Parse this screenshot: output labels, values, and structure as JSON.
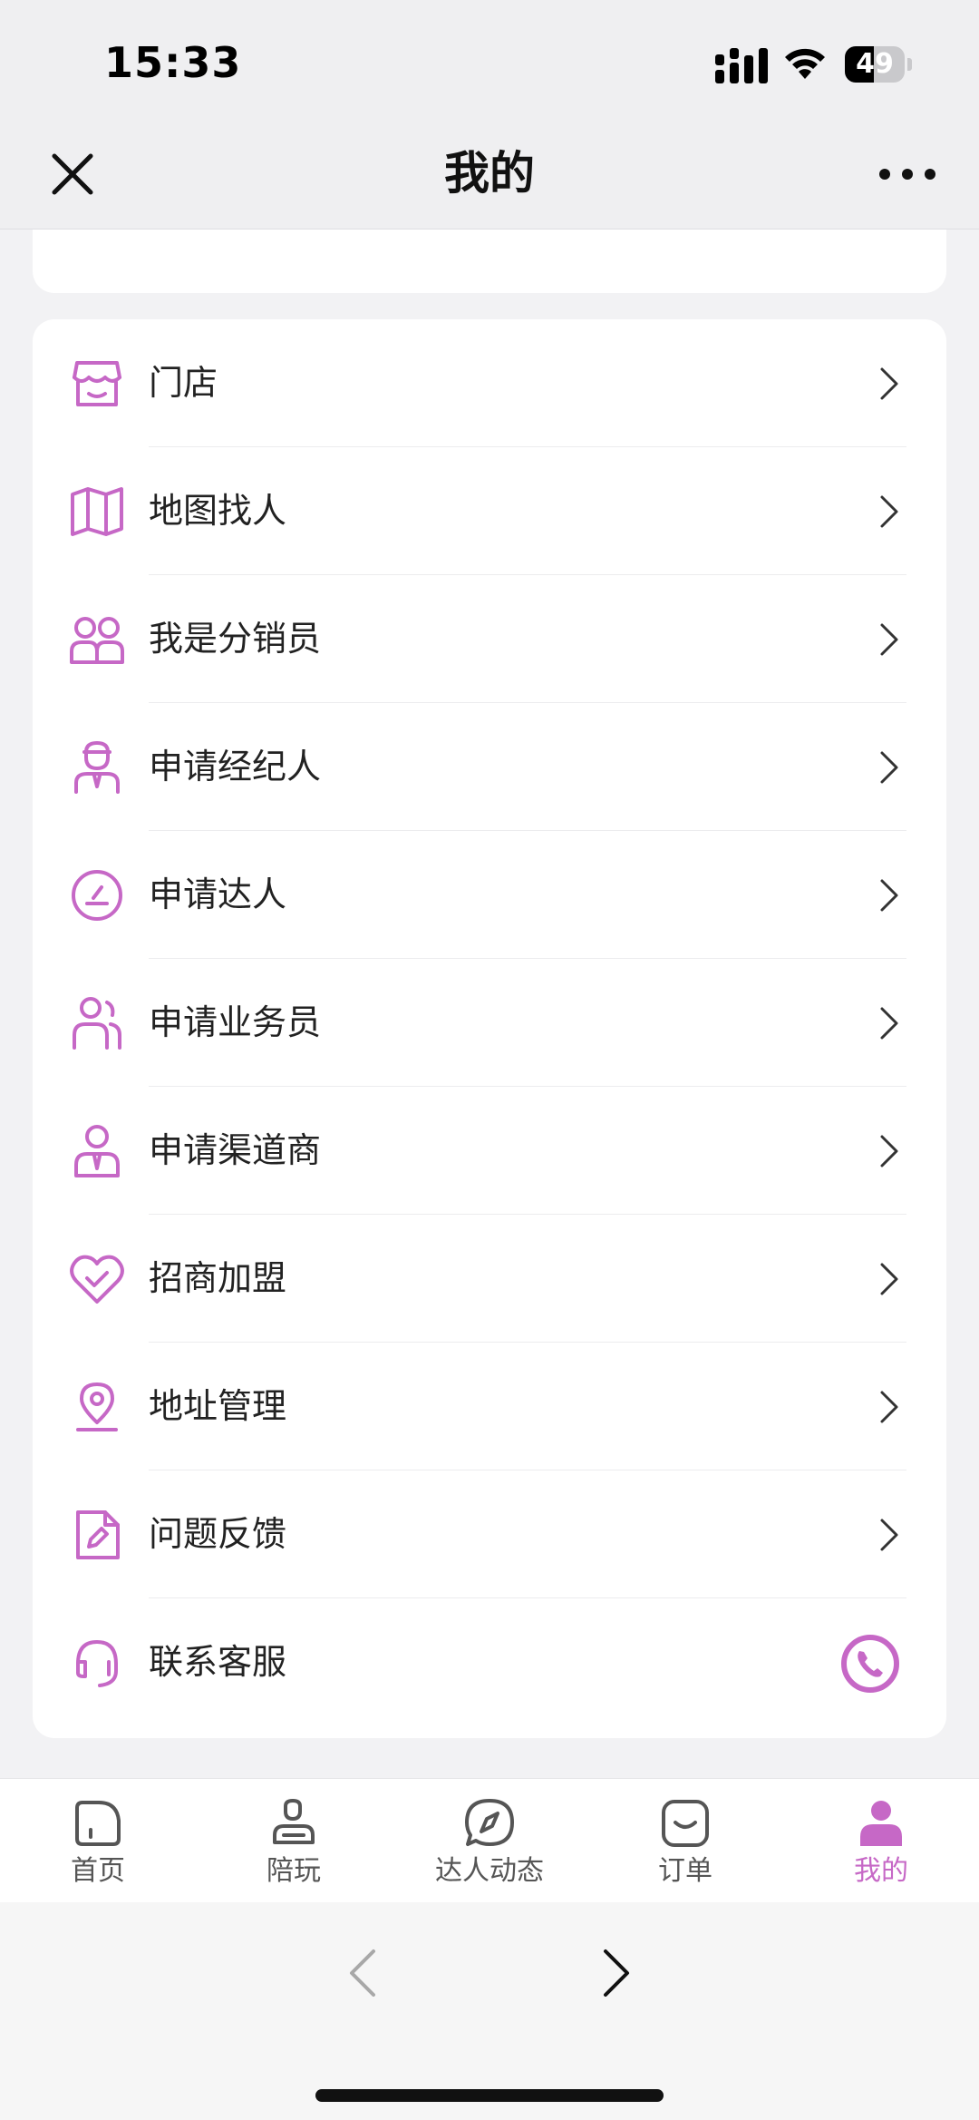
{
  "status_bar": {
    "time": "15:33",
    "battery": "49",
    "battery_level_percent": 49
  },
  "nav": {
    "title": "我的"
  },
  "accent_color": "#c668c6",
  "menu": {
    "items": [
      {
        "label": "门店",
        "icon": "store-icon"
      },
      {
        "label": "地图找人",
        "icon": "map-icon"
      },
      {
        "label": "我是分销员",
        "icon": "users-icon"
      },
      {
        "label": "申请经纪人",
        "icon": "agent-icon"
      },
      {
        "label": "申请达人",
        "icon": "speed-gauge-icon"
      },
      {
        "label": "申请业务员",
        "icon": "salesperson-icon"
      },
      {
        "label": "申请渠道商",
        "icon": "distributor-icon"
      },
      {
        "label": "招商加盟",
        "icon": "heart-icon"
      },
      {
        "label": "地址管理",
        "icon": "location-pin-icon"
      },
      {
        "label": "问题反馈",
        "icon": "feedback-edit-icon"
      },
      {
        "label": "联系客服",
        "icon": "headset-icon",
        "action_icon": "phone-icon"
      }
    ]
  },
  "tabs": [
    {
      "label": "首页",
      "icon": "home-icon"
    },
    {
      "label": "陪玩",
      "icon": "companion-icon"
    },
    {
      "label": "达人动态",
      "icon": "compass-icon"
    },
    {
      "label": "订单",
      "icon": "order-bag-icon"
    },
    {
      "label": "我的",
      "icon": "profile-icon",
      "active": true
    }
  ]
}
